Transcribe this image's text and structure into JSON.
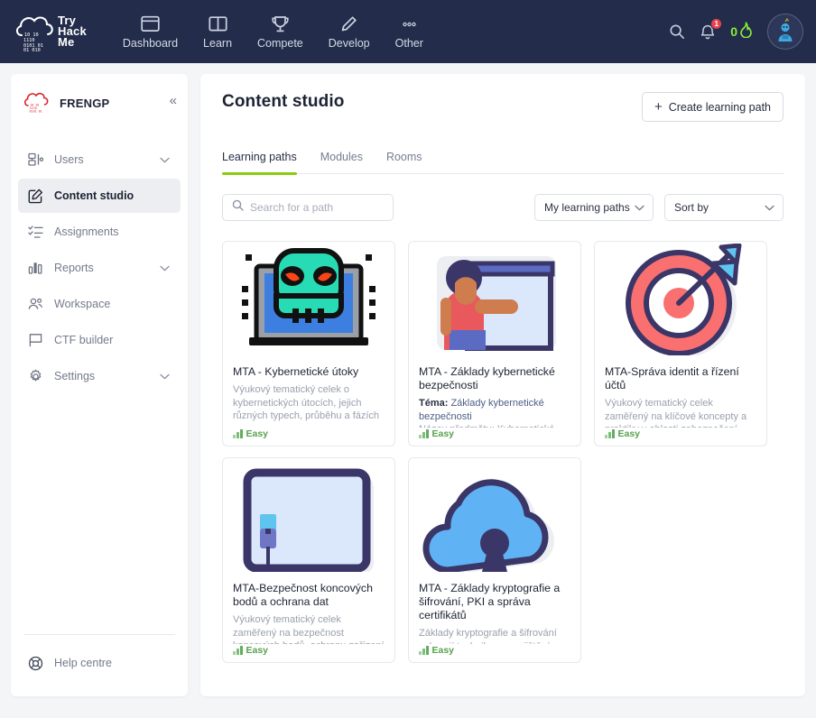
{
  "topnav": {
    "brand": {
      "name": "TryHackMe",
      "line1": "Try",
      "line2": "Hack",
      "line3": "Me"
    },
    "items": [
      {
        "label": "Dashboard",
        "icon": "window-icon"
      },
      {
        "label": "Learn",
        "icon": "book-icon"
      },
      {
        "label": "Compete",
        "icon": "trophy-icon"
      },
      {
        "label": "Develop",
        "icon": "pencil-icon"
      },
      {
        "label": "Other",
        "icon": "ellipsis-icon"
      }
    ],
    "search_icon": "search-icon",
    "notifications_icon": "bell-icon",
    "notifications_count": "1",
    "streak_count": "0",
    "streak_icon": "flame-icon",
    "streak_color": "#88f039",
    "avatar_icon": "avatar"
  },
  "sidebar": {
    "org_name": "FRENGP",
    "collapse_icon": "chevron-double-left-icon",
    "items": [
      {
        "label": "Users",
        "icon": "users-icon",
        "chevron": true,
        "active": false
      },
      {
        "label": "Content studio",
        "icon": "edit-square-icon",
        "chevron": false,
        "active": true
      },
      {
        "label": "Assignments",
        "icon": "list-checks-icon",
        "chevron": false,
        "active": false
      },
      {
        "label": "Reports",
        "icon": "bar-chart-icon",
        "chevron": true,
        "active": false
      },
      {
        "label": "Workspace",
        "icon": "people-group-icon",
        "chevron": false,
        "active": false
      },
      {
        "label": "CTF builder",
        "icon": "flag-icon",
        "chevron": false,
        "active": false
      },
      {
        "label": "Settings",
        "icon": "gear-icon",
        "chevron": true,
        "active": false
      }
    ],
    "help": {
      "label": "Help centre",
      "icon": "lifebuoy-icon"
    }
  },
  "main": {
    "title": "Content studio",
    "create_button": {
      "label": "Create learning path",
      "icon": "plus-icon"
    },
    "tabs": [
      {
        "label": "Learning paths",
        "active": true
      },
      {
        "label": "Modules",
        "active": false
      },
      {
        "label": "Rooms",
        "active": false
      }
    ],
    "accent_color": "#88cc14",
    "search": {
      "placeholder": "Search for a path",
      "value": "",
      "icon": "search-icon"
    },
    "filter_select": {
      "value": "My learning paths",
      "icon": "chevron-down-icon"
    },
    "sort_select": {
      "value": "Sort by",
      "icon": "chevron-down-icon"
    },
    "cards": [
      {
        "title": "MTA - Kybernetické útoky",
        "desc_plain": "Výukový tematický celek o kybernetických útocích, jejich různých typech, průběhu a fázích útoků, a metodách, jak těmto",
        "difficulty": "Easy",
        "thumb": "skull-on-laptop-illustration"
      },
      {
        "title": "MTA - Základy kybernetické bezpečnosti",
        "desc_label": "Téma:",
        "desc_highlight": " Základy kybernetické bezpečnosti",
        "desc_plain": "Název předmětu: Kybernetická",
        "difficulty": "Easy",
        "thumb": "presenter-whiteboard-illustration"
      },
      {
        "title": "MTA-Správa identit a řízení účtů",
        "desc_plain": "Výukový tematický celek zaměřený na klíčové koncepty a praktiky v oblasti zabezpečení přístupu a",
        "difficulty": "Easy",
        "thumb": "target-arrow-illustration"
      },
      {
        "title": "MTA-Bezpečnost koncových bodů a ochrana dat",
        "desc_plain": "Výukový tematický celek zaměřený na bezpečnost koncových bodů, ochranu zařízení a dat před",
        "difficulty": "Easy",
        "thumb": "monitor-plug-illustration"
      },
      {
        "title": "MTA - Základy kryptografie a šifrování, PKI a správa certifikátů",
        "desc_plain": "Základy kryptografie a šifrování zahrnují techniky pro zajištění",
        "difficulty": "Easy",
        "thumb": "cloud-keyhole-illustration"
      }
    ]
  }
}
